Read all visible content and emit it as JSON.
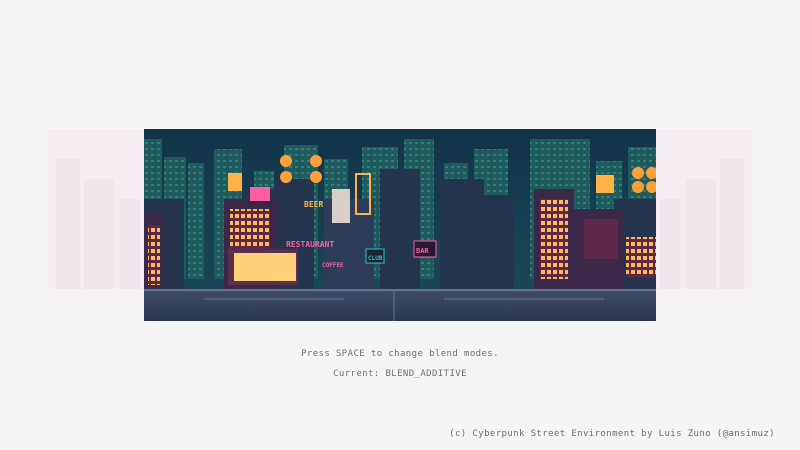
{
  "window": {
    "instructions": "Press SPACE to change blend modes.",
    "current_label": "Current: BLEND_ADDITIVE",
    "credits": "(c) Cyberpunk Street Environment by Luis Zuno (@ansimuz)"
  },
  "scene": {
    "name": "cyberpunk-street",
    "signs": {
      "beer": "BEER",
      "restaurant": "RESTAURANT",
      "coffee": "COFFEE",
      "club": "CLUB",
      "bar": "BAR"
    }
  },
  "colors": {
    "background": "#f5f5f5",
    "sky": "#14374a",
    "text": "#6e6e6e",
    "neon_pink": "#ff5fa0",
    "neon_orange": "#ffb347",
    "neon_cyan": "#34c6c6"
  }
}
